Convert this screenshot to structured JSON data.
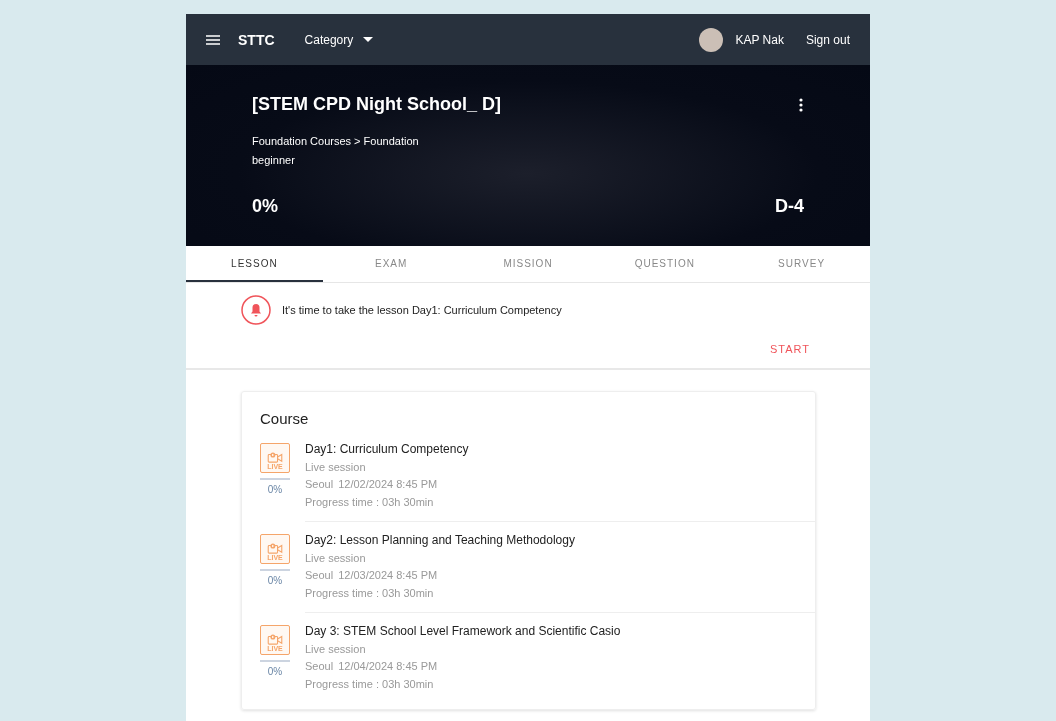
{
  "header": {
    "brand": "STTC",
    "category": "Category",
    "user": "KAP Nak",
    "sign_out": "Sign out"
  },
  "hero": {
    "title": "[STEM CPD Night School_ D]",
    "path": "Foundation Courses > Foundation",
    "level": "beginner",
    "progress": "0%",
    "dday": "D-4"
  },
  "tabs": [
    {
      "label": "LESSON",
      "selected": true
    },
    {
      "label": "EXAM",
      "selected": false
    },
    {
      "label": "MISSION",
      "selected": false
    },
    {
      "label": "QUESTION",
      "selected": false
    },
    {
      "label": "SURVEY",
      "selected": false
    }
  ],
  "notice": {
    "text": "It's time to take the lesson Day1: Curriculum Competency",
    "action": "START"
  },
  "course": {
    "title": "Course",
    "lessons": [
      {
        "icon_text": "LIVE",
        "level": 0,
        "progress": "0%",
        "title": "Day1: Curriculum Competency",
        "type": "Live session",
        "place": "Seoul",
        "datetime": "12/02/2024 8:45 PM",
        "time": "Progress time : 03h 30min"
      },
      {
        "icon_text": "LIVE",
        "level": 0,
        "progress": "0%",
        "title": "Day2: Lesson Planning and Teaching Methodology",
        "type": "Live session",
        "place": "Seoul",
        "datetime": "12/03/2024 8:45 PM",
        "time": "Progress time : 03h 30min"
      },
      {
        "icon_text": "LIVE",
        "level": 0,
        "progress": "0%",
        "title": "Day 3: STEM School Level Framework and Scientific Casio",
        "type": "Live session",
        "place": "Seoul",
        "datetime": "12/04/2024 8:45 PM",
        "time": "Progress time : 03h 30min"
      }
    ]
  }
}
